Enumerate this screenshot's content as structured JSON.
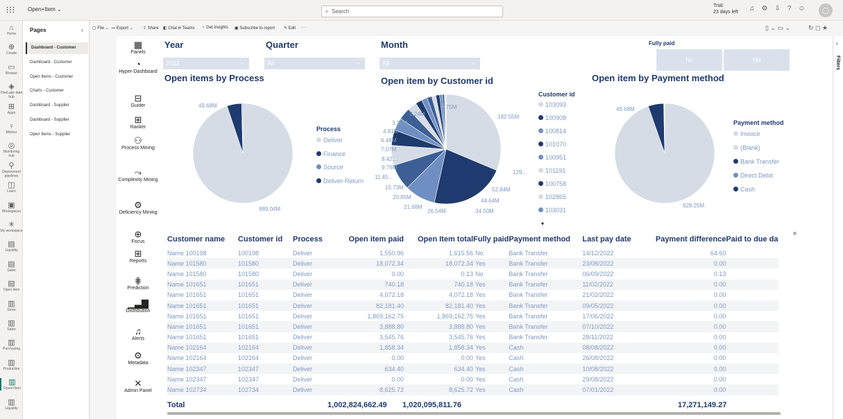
{
  "app": {
    "name": "Open+Item",
    "search_placeholder": "Search",
    "trial": [
      "Trial:",
      "23 days left"
    ]
  },
  "left_rail": [
    {
      "label": "Home",
      "icon": "home-icon",
      "glyph": "⌂"
    },
    {
      "label": "Create",
      "icon": "create-icon",
      "glyph": "⊕"
    },
    {
      "label": "Browse",
      "icon": "browse-icon",
      "glyph": "▭"
    },
    {
      "label": "OneLake data hub",
      "icon": "onelake-icon",
      "glyph": "◈"
    },
    {
      "label": "Apps",
      "icon": "apps-icon",
      "glyph": "⊞"
    },
    {
      "label": "Metrics",
      "icon": "metrics-icon",
      "glyph": "♀"
    },
    {
      "label": "Monitoring hub",
      "icon": "monitoring-icon",
      "glyph": "◎"
    },
    {
      "label": "Deployment pipelines",
      "icon": "deployment-icon",
      "glyph": "⚲"
    },
    {
      "label": "Learn",
      "icon": "learn-icon",
      "glyph": "◫"
    },
    {
      "label": "Workspaces",
      "icon": "workspaces-icon",
      "glyph": "▣"
    },
    {
      "label": "My workspace",
      "icon": "my-workspace-icon",
      "glyph": "✳"
    },
    {
      "label": "Liquidity",
      "icon": "report-icon",
      "glyph": "▤"
    },
    {
      "label": "Sales",
      "icon": "report-icon",
      "glyph": "▤"
    },
    {
      "label": "Open-item",
      "icon": "report-icon",
      "glyph": "▤"
    },
    {
      "label": "Stock",
      "icon": "app-icon",
      "glyph": "▥"
    },
    {
      "label": "Sales",
      "icon": "app-icon",
      "glyph": "▥"
    },
    {
      "label": "Purchasing",
      "icon": "app-icon",
      "glyph": "▥"
    },
    {
      "label": "Production",
      "icon": "app-icon",
      "glyph": "▥"
    },
    {
      "label": "Open+Item",
      "icon": "app-icon",
      "glyph": "▥",
      "active": true
    },
    {
      "label": "Liquidity",
      "icon": "app-icon",
      "glyph": "▥"
    }
  ],
  "pages": {
    "header": "Pages",
    "items": [
      "Dashboard - Customer",
      "Dashboard - Customer",
      "Open Items - Customer",
      "Charts - Customer",
      "Dashboard - Supplier",
      "Dashboard - Supplier",
      "Open Items - Supplier"
    ]
  },
  "cmdbar": [
    "File",
    "Export",
    "Share",
    "Chat in Teams",
    "Get insights",
    "Subscribe to report",
    "Edit",
    "···"
  ],
  "nav": [
    {
      "label": "Panels",
      "icon": "panels-icon",
      "glyph": "▦"
    },
    {
      "label": "Hyper-Dashboard",
      "icon": "gauge-icon",
      "glyph": "◔"
    },
    {
      "label": "Guider",
      "icon": "guider-icon",
      "glyph": "⊟"
    },
    {
      "label": "Ranker",
      "icon": "ranker-icon",
      "glyph": "⊞"
    },
    {
      "label": "Process Mining",
      "icon": "process-mining-icon",
      "glyph": "⚇"
    },
    {
      "label": "Complexity Mining",
      "icon": "complexity-icon",
      "glyph": "⤳"
    },
    {
      "label": "Deficiency Mining",
      "icon": "deficiency-icon",
      "glyph": "⚙"
    },
    {
      "label": "Focus",
      "icon": "focus-icon",
      "glyph": "⊕"
    },
    {
      "label": "Reports",
      "icon": "reports-icon",
      "glyph": "⊞"
    },
    {
      "label": "Prediction",
      "icon": "prediction-icon",
      "glyph": "⋕"
    },
    {
      "label": "Distribution",
      "icon": "distribution-icon",
      "glyph": "▁▃▇"
    },
    {
      "label": "Alerts",
      "icon": "bell-icon",
      "glyph": "♫"
    },
    {
      "label": "Metadata",
      "icon": "metadata-icon",
      "glyph": "⚙"
    },
    {
      "label": "Admin Panel",
      "icon": "admin-icon",
      "glyph": "✕"
    }
  ],
  "slicers": {
    "year": {
      "title": "Year",
      "value": "2022"
    },
    "quarter": {
      "title": "Quarter",
      "value": "All"
    },
    "month": {
      "title": "Month",
      "value": "All"
    },
    "fully_paid": {
      "title": "Fully paid",
      "options": [
        "No",
        "Yes"
      ]
    }
  },
  "colors": {
    "dark": "#1f3a6e",
    "mid": "#3d5f96",
    "blue": "#6f8fc3",
    "light": "#d6dce6",
    "text": "#7f99c2"
  },
  "chart_data": [
    {
      "type": "pie",
      "title": "Open items by Process",
      "legend_title": "Process",
      "legend": [
        "Deliver",
        "Finance",
        "Source",
        "Deliver-Return"
      ],
      "values": [
        989.04,
        49.68,
        1.1,
        2.9
      ],
      "value_labels": [
        "989.04M",
        "49.68M"
      ]
    },
    {
      "type": "pie",
      "title": "Open item by Customer id",
      "legend_title": "Customer id",
      "legend": [
        "103093",
        "100908",
        "100814",
        "101070",
        "100951",
        "101191",
        "100758",
        "102865",
        "103031"
      ],
      "value_labels": [
        "182.55M",
        "129...",
        "52.84M",
        "44.64M",
        "34.50M",
        "26.54M",
        "21.68M",
        "20.85M",
        "15.73M",
        "11.45...",
        "9.76M",
        "8.42...",
        "7.07M",
        "6.48M",
        "4.81M",
        "3.39M",
        "2.24M",
        "0.75M"
      ],
      "values": [
        182.55,
        129,
        52.84,
        44.64,
        34.5,
        26.54,
        21.68,
        20.85,
        15.73,
        11.45,
        9.76,
        8.42,
        7.07,
        6.48,
        4.81,
        3.39,
        2.24,
        0.75
      ]
    },
    {
      "type": "pie",
      "title": "Open item by Payment method",
      "legend_title": "Payment method",
      "legend": [
        "Invoice",
        "(Blank)",
        "Bank Transfer",
        "Direct Debit",
        "Cash"
      ],
      "values": [
        928.25,
        49.68,
        1.5,
        1.0,
        0.5
      ],
      "value_labels": [
        "928.25M",
        "49.68M"
      ]
    }
  ],
  "table": {
    "columns": [
      "Customer name",
      "Customer id",
      "Process",
      "Open item paid",
      "Open Item total",
      "Fully paid",
      "Payment method",
      "Last pay date",
      "Payment difference",
      "Paid to due da"
    ],
    "rows": [
      [
        "Name 100198",
        "100198",
        "Deliver",
        "1,550.96",
        "1,615.56",
        "No",
        "Bank Transfer",
        "14/12/2022",
        "64.60"
      ],
      [
        "Name 101580",
        "101580",
        "Deliver",
        "18,072.34",
        "18,072.34",
        "Yes",
        "Bank Transfer",
        "23/08/2022",
        "0.00"
      ],
      [
        "Name 101580",
        "101580",
        "Deliver",
        "0.00",
        "0.13",
        "No",
        "Bank Transfer",
        "06/09/2022",
        "0.13"
      ],
      [
        "Name 101651",
        "101651",
        "Deliver",
        "740.18",
        "740.18",
        "Yes",
        "Bank Transfer",
        "11/02/2022",
        "0.00"
      ],
      [
        "Name 101651",
        "101651",
        "Deliver",
        "4,072.18",
        "4,072.18",
        "Yes",
        "Bank Transfer",
        "21/02/2022",
        "0.00"
      ],
      [
        "Name 101651",
        "101651",
        "Deliver",
        "82,181.40",
        "82,181.40",
        "Yes",
        "Bank Transfer",
        "09/05/2022",
        "0.00"
      ],
      [
        "Name 101651",
        "101651",
        "Deliver",
        "1,869,162.75",
        "1,869,162.75",
        "Yes",
        "Bank Transfer",
        "17/06/2022",
        "0.00"
      ],
      [
        "Name 101651",
        "101651",
        "Deliver",
        "3,888.80",
        "3,888.80",
        "Yes",
        "Bank Transfer",
        "07/10/2022",
        "0.00"
      ],
      [
        "Name 101651",
        "101651",
        "Deliver",
        "3,545.76",
        "3,545.76",
        "Yes",
        "Bank Transfer",
        "28/11/2022",
        "0.00"
      ],
      [
        "Name 102164",
        "102164",
        "Deliver",
        "1,858.34",
        "1,858.34",
        "Yes",
        "Cash",
        "08/08/2022",
        "0.00"
      ],
      [
        "Name 102164",
        "102164",
        "Deliver",
        "0.00",
        "0.00",
        "Yes",
        "Cash",
        "26/08/2022",
        "0.00"
      ],
      [
        "Name 102347",
        "102347",
        "Deliver",
        "634.40",
        "634.40",
        "Yes",
        "Cash",
        "10/08/2022",
        "0.00"
      ],
      [
        "Name 102347",
        "102347",
        "Deliver",
        "0.00",
        "0.00",
        "Yes",
        "Cash",
        "29/08/2022",
        "0.00"
      ],
      [
        "Name 102734",
        "102734",
        "Deliver",
        "8,625.72",
        "8,625.72",
        "Yes",
        "Cash",
        "07/01/2022",
        "0.00"
      ]
    ],
    "total": {
      "label": "Total",
      "paid": "1,002,824,662.49",
      "total": "1,020,095,811.76",
      "difference": "17,271,149.27"
    }
  },
  "filters_label": "Filters"
}
